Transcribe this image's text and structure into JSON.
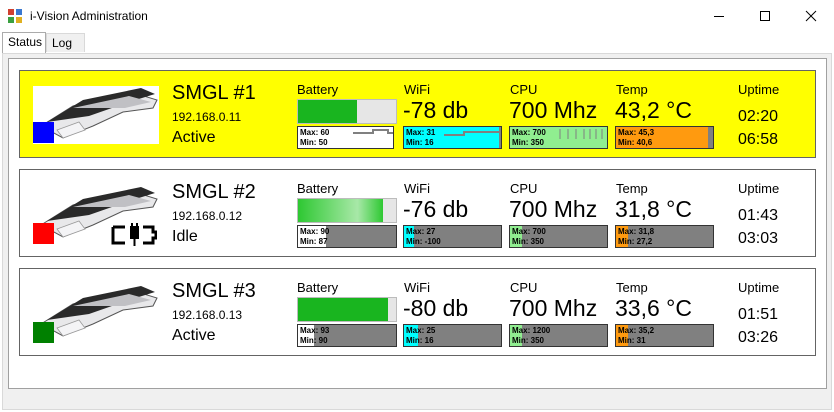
{
  "window": {
    "title": "i-Vision Administration"
  },
  "tabs": [
    {
      "label": "Status",
      "active": true
    },
    {
      "label": "Log",
      "active": false
    }
  ],
  "labels": {
    "battery": "Battery",
    "wifi": "WiFi",
    "cpu": "CPU",
    "temp": "Temp",
    "uptime": "Uptime"
  },
  "colors": {
    "highlight": "#ffff00",
    "battery": "#19b51f",
    "wifi": "#00ffff",
    "cpu": "#90ee90",
    "temp": "#ff9a0f",
    "status_active_1": "#0000ff",
    "status_idle": "#ff0000",
    "status_active_3": "#008000"
  },
  "devices": [
    {
      "name": "SMGL #1",
      "ip": "192.168.0.11",
      "state": "Active",
      "status_color": "#0000ff",
      "highlighted": true,
      "charging": false,
      "battery_level": 0.6,
      "battery_max": "Max: 60",
      "battery_min": "Min: 50",
      "wifi": "-78 db",
      "wifi_max": "Max: 31",
      "wifi_min": "Min: 16",
      "cpu": "700 Mhz",
      "cpu_max": "Max: 700",
      "cpu_min": "Min: 350",
      "temp": "43,2 °C",
      "temp_max": "Max: 45,3",
      "temp_min": "Min: 40,6",
      "uptime_1": "02:20",
      "uptime_2": "06:58"
    },
    {
      "name": "SMGL #2",
      "ip": "192.168.0.12",
      "state": "Idle",
      "status_color": "#ff0000",
      "highlighted": false,
      "charging": true,
      "battery_level": 0.87,
      "battery_max": "Max: 90",
      "battery_min": "Min: 87",
      "wifi": "-76 db",
      "wifi_max": "Max: 27",
      "wifi_min": "Min: -100",
      "cpu": "700 Mhz",
      "cpu_max": "Max: 700",
      "cpu_min": "Min: 350",
      "temp": "31,8 °C",
      "temp_max": "Max: 31,8",
      "temp_min": "Min: 27,2",
      "uptime_1": "01:43",
      "uptime_2": "03:03"
    },
    {
      "name": "SMGL #3",
      "ip": "192.168.0.13",
      "state": "Active",
      "status_color": "#008000",
      "highlighted": false,
      "charging": false,
      "battery_level": 0.92,
      "battery_max": "Max: 93",
      "battery_min": "Min: 90",
      "wifi": "-80 db",
      "wifi_max": "Max: 25",
      "wifi_min": "Min: 16",
      "cpu": "700 Mhz",
      "cpu_max": "Max: 1200",
      "cpu_min": "Min: 350",
      "temp": "33,6 °C",
      "temp_max": "Max: 35,2",
      "temp_min": "Min: 31",
      "uptime_1": "01:51",
      "uptime_2": "03:26"
    }
  ]
}
